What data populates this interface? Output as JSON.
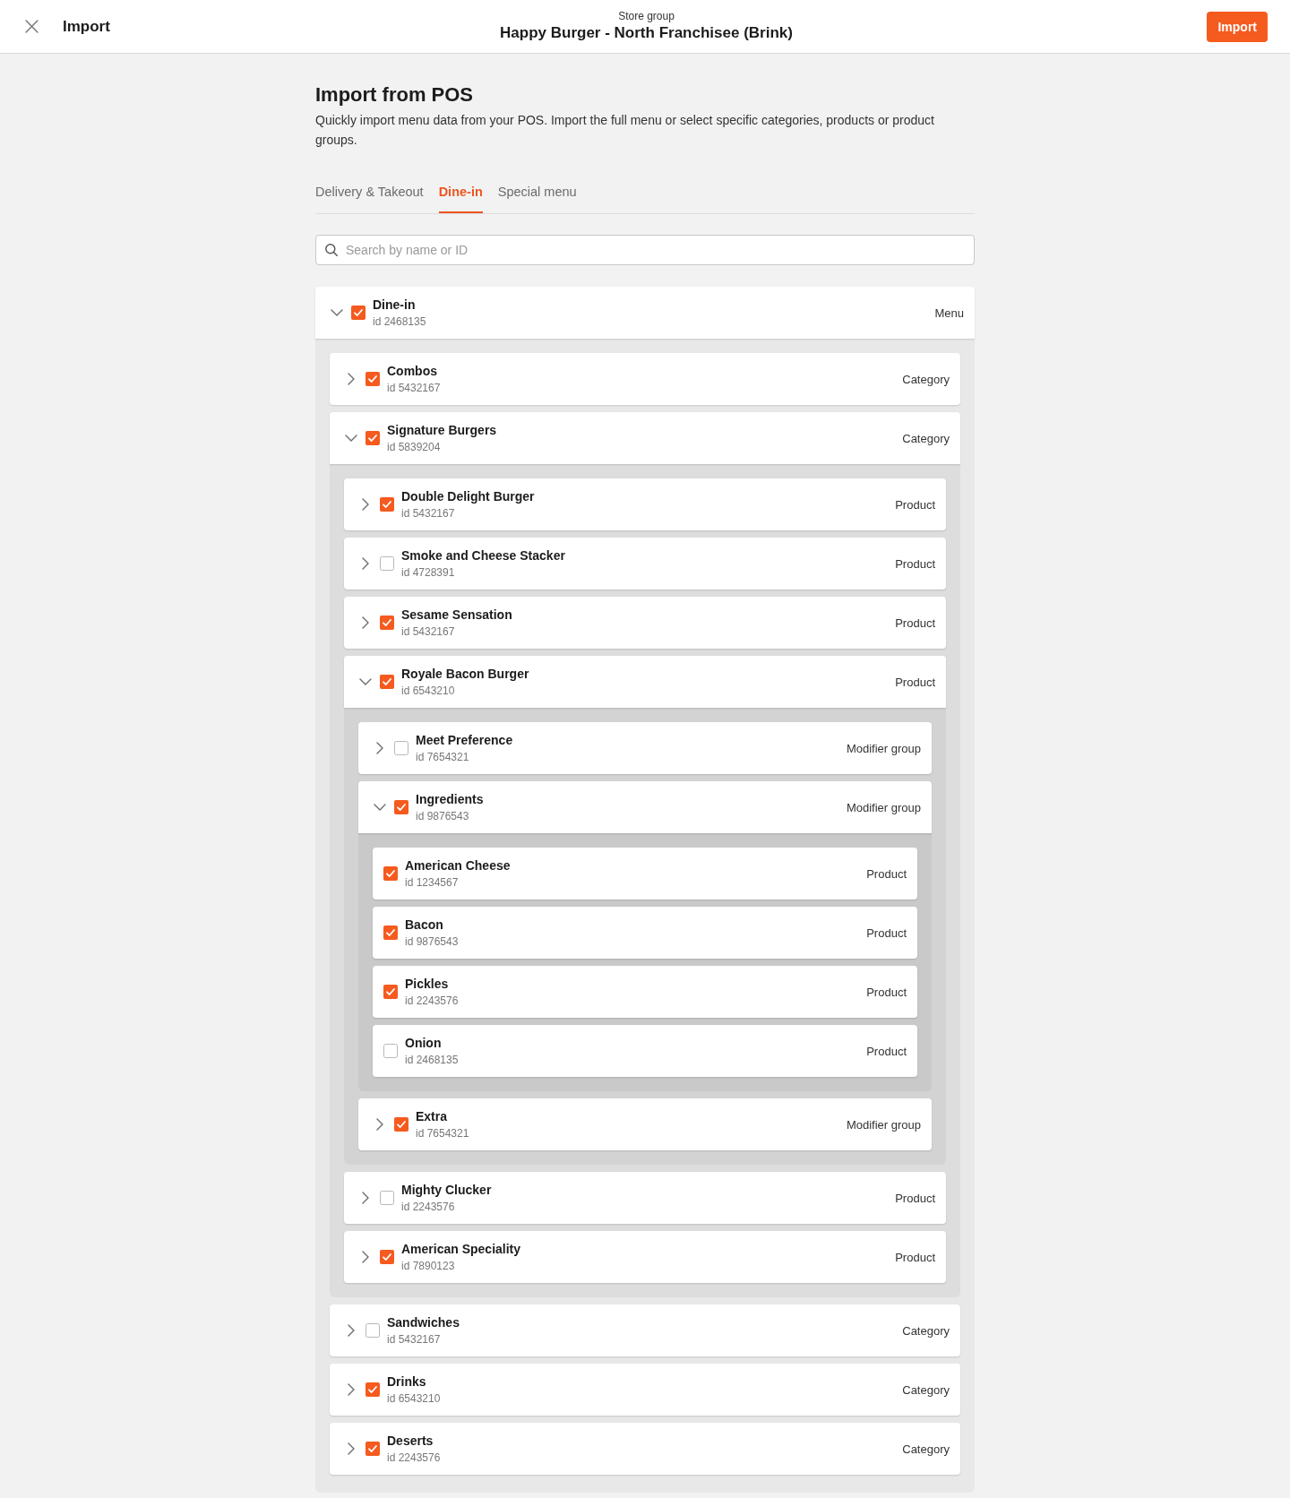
{
  "header": {
    "title": "Import",
    "context_label": "Store group",
    "store_name": "Happy Burger - North Franchisee (Brink)",
    "action_button": "Import"
  },
  "intro": {
    "title": "Import from POS",
    "description": "Quickly import menu data from your POS. Import the full menu or select specific categories, products or product groups."
  },
  "tabs": [
    {
      "label": "Delivery & Takeout",
      "selected": false
    },
    {
      "label": "Dine-in",
      "selected": true
    },
    {
      "label": "Special menu",
      "selected": false
    }
  ],
  "search": {
    "placeholder": "Search by name or ID"
  },
  "tree": [
    {
      "name": "Dine-in",
      "id_label": "id 2468135",
      "type": "Menu",
      "checked": true,
      "expanded": true,
      "children": [
        {
          "name": "Combos",
          "id_label": "id 5432167",
          "type": "Category",
          "checked": true,
          "expanded": false
        },
        {
          "name": "Signature Burgers",
          "id_label": "id 5839204",
          "type": "Category",
          "checked": true,
          "expanded": true,
          "children": [
            {
              "name": "Double Delight Burger",
              "id_label": "id 5432167",
              "type": "Product",
              "checked": true,
              "expanded": false
            },
            {
              "name": "Smoke and Cheese Stacker",
              "id_label": "id 4728391",
              "type": "Product",
              "checked": false,
              "expanded": false
            },
            {
              "name": "Sesame Sensation",
              "id_label": "id 5432167",
              "type": "Product",
              "checked": true,
              "expanded": false
            },
            {
              "name": "Royale Bacon Burger",
              "id_label": "id 6543210",
              "type": "Product",
              "checked": true,
              "expanded": true,
              "children": [
                {
                  "name": "Meet Preference",
                  "id_label": "id 7654321",
                  "type": "Modifier group",
                  "checked": false,
                  "expanded": false
                },
                {
                  "name": "Ingredients",
                  "id_label": "id 9876543",
                  "type": "Modifier group",
                  "checked": true,
                  "expanded": true,
                  "children": [
                    {
                      "name": "American Cheese",
                      "id_label": "id 1234567",
                      "type": "Product",
                      "checked": true
                    },
                    {
                      "name": "Bacon",
                      "id_label": "id 9876543",
                      "type": "Product",
                      "checked": true
                    },
                    {
                      "name": "Pickles",
                      "id_label": "id 2243576",
                      "type": "Product",
                      "checked": true
                    },
                    {
                      "name": "Onion",
                      "id_label": "id 2468135",
                      "type": "Product",
                      "checked": false
                    }
                  ]
                },
                {
                  "name": "Extra",
                  "id_label": "id 7654321",
                  "type": "Modifier group",
                  "checked": true,
                  "expanded": false
                }
              ]
            },
            {
              "name": "Mighty Clucker",
              "id_label": "id 2243576",
              "type": "Product",
              "checked": false,
              "expanded": false
            },
            {
              "name": "American Speciality",
              "id_label": "id 7890123",
              "type": "Product",
              "checked": true,
              "expanded": false
            }
          ]
        },
        {
          "name": "Sandwiches",
          "id_label": "id 5432167",
          "type": "Category",
          "checked": false,
          "expanded": false
        },
        {
          "name": "Drinks",
          "id_label": "id 6543210",
          "type": "Category",
          "checked": true,
          "expanded": false
        },
        {
          "name": "Deserts",
          "id_label": "id 2243576",
          "type": "Category",
          "checked": true,
          "expanded": false
        }
      ]
    }
  ]
}
